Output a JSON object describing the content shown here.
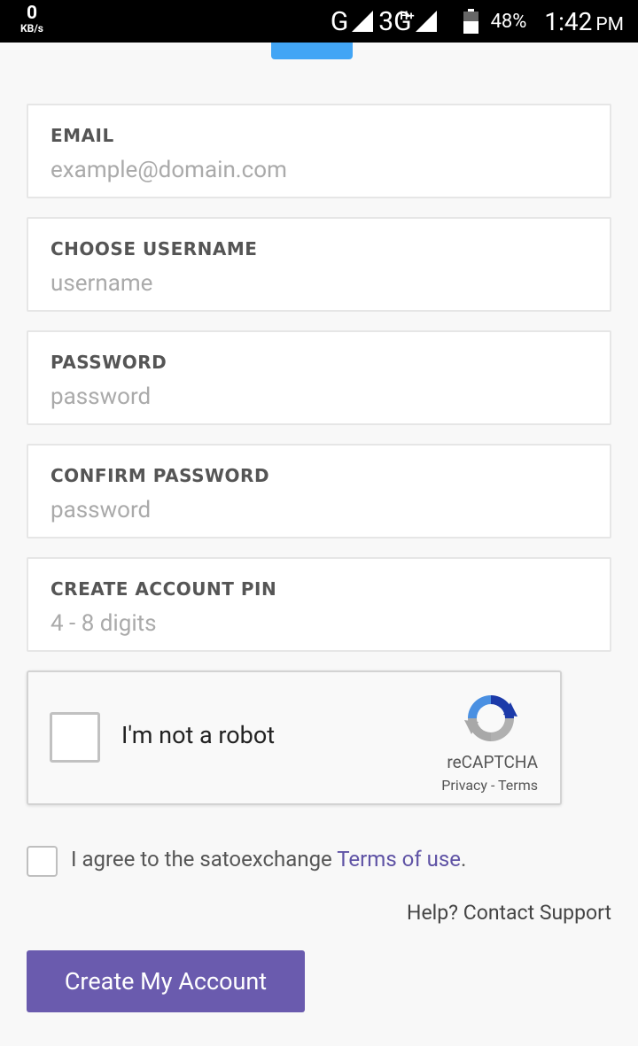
{
  "status_bar": {
    "speed_value": "0",
    "speed_unit": "KB/s",
    "network_primary": "G",
    "network_secondary": "3G",
    "network_secondary_badge": "H+",
    "battery_percent": "48%",
    "time": "1:42",
    "ampm": "PM",
    "icons": [
      "signal-icon",
      "signal-icon",
      "battery-icon"
    ]
  },
  "form": {
    "email": {
      "label": "EMAIL",
      "placeholder": "example@domain.com",
      "value": ""
    },
    "username": {
      "label": "CHOOSE USERNAME",
      "placeholder": "username",
      "value": ""
    },
    "password": {
      "label": "PASSWORD",
      "placeholder": "password",
      "value": ""
    },
    "confirm_password": {
      "label": "CONFIRM PASSWORD",
      "placeholder": "password",
      "value": ""
    },
    "pin": {
      "label": "CREATE ACCOUNT PIN",
      "placeholder": "4 - 8 digits",
      "value": ""
    }
  },
  "recaptcha": {
    "label": "I'm not a robot",
    "brand": "reCAPTCHA",
    "privacy": "Privacy",
    "separator": " - ",
    "terms": "Terms"
  },
  "agree": {
    "prefix": "I agree to the satoexchange ",
    "link": "Terms of use",
    "suffix": "."
  },
  "help": "Help? Contact Support",
  "submit_label": "Create My Account",
  "colors": {
    "primary": "#6a5bae",
    "link": "#5f53a5",
    "remnant_button": "#42a5f5"
  }
}
